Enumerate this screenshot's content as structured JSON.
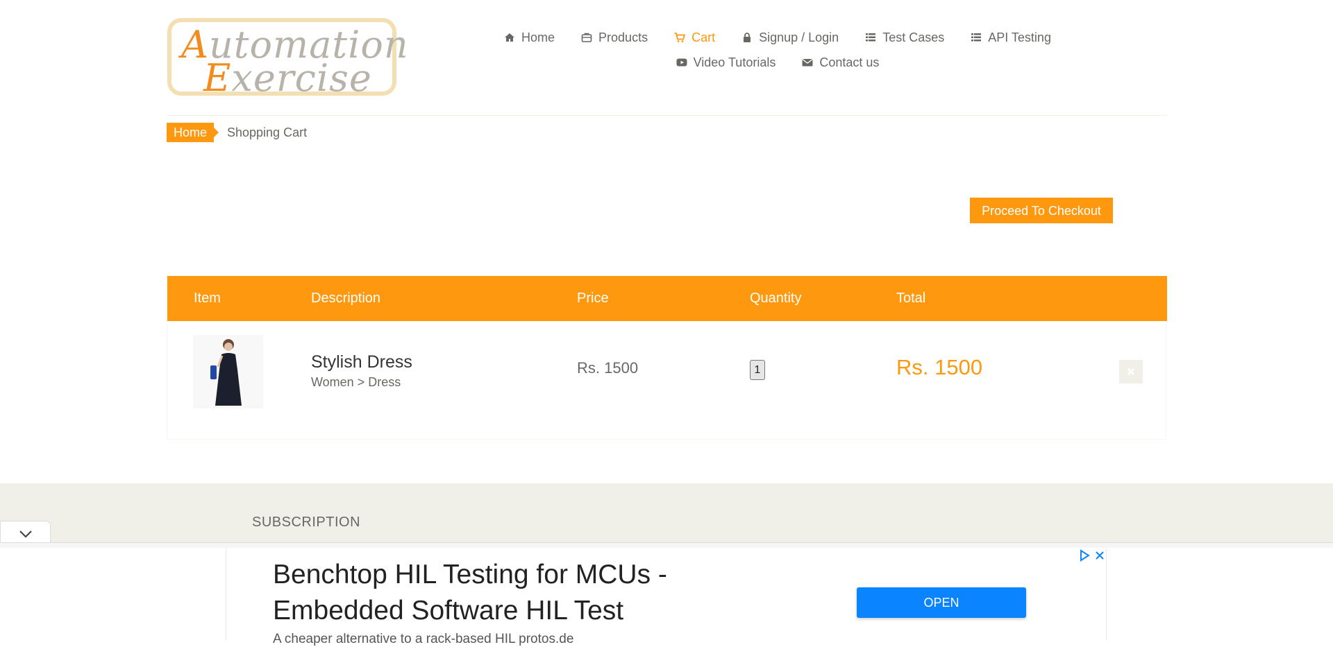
{
  "header": {
    "logo": {
      "line1_initial": "A",
      "line1_rest": "utomation",
      "line2_initial": "E",
      "line2_rest": "xercise"
    },
    "nav_primary": [
      {
        "label": "Home",
        "icon": "home-icon"
      },
      {
        "label": "Products",
        "icon": "products-icon"
      },
      {
        "label": "Cart",
        "icon": "cart-icon",
        "active": true
      },
      {
        "label": "Signup / Login",
        "icon": "lock-icon"
      },
      {
        "label": "Test Cases",
        "icon": "list-icon"
      },
      {
        "label": "API Testing",
        "icon": "list-icon"
      }
    ],
    "nav_secondary": [
      {
        "label": "Video Tutorials",
        "icon": "youtube-icon"
      },
      {
        "label": "Contact us",
        "icon": "envelope-icon"
      }
    ]
  },
  "breadcrumb": {
    "home": "Home",
    "current": "Shopping Cart"
  },
  "checkout_button": "Proceed To Checkout",
  "cart": {
    "headers": [
      "Item",
      "Description",
      "Price",
      "Quantity",
      "Total"
    ],
    "rows": [
      {
        "name": "Stylish Dress",
        "category": "Women > Dress",
        "price": "Rs. 1500",
        "quantity": "1",
        "total": "Rs. 1500"
      }
    ]
  },
  "footer": {
    "subscription": "SUBSCRIPTION"
  },
  "ad": {
    "title": "Benchtop HIL Testing for MCUs - Embedded Software HIL Test",
    "subtitle": "A cheaper alternative to a rack-based HIL protos.de",
    "button": "OPEN"
  },
  "colors": {
    "accent": "#fe980f",
    "text": "#696763",
    "footer_bg": "#f0f0e9",
    "ad_button": "#0a84ff"
  }
}
